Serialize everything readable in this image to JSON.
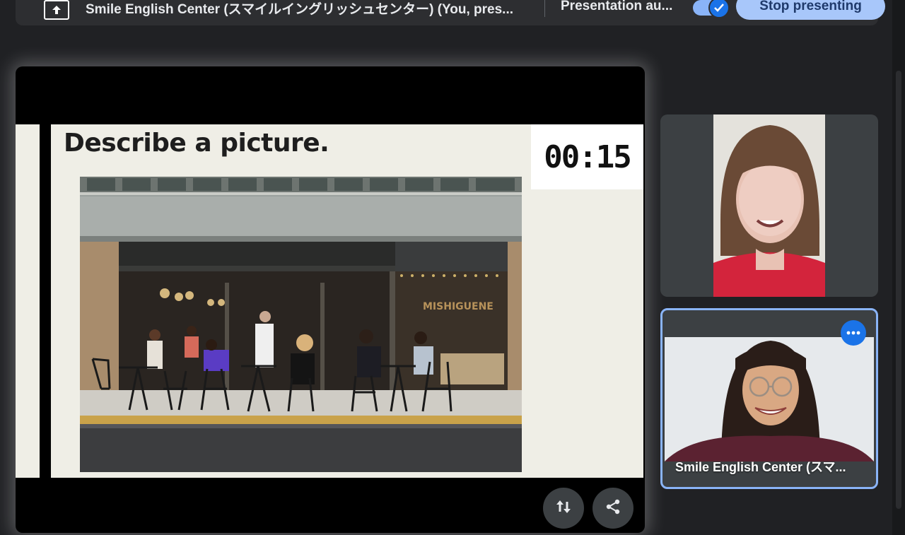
{
  "presenting_bar": {
    "title": "Smile English Center (スマイルイングリッシュセンター) (You, pres...",
    "autoplay_label": "Presentation au...",
    "autoplay_on": true,
    "stop_label": "Stop presenting",
    "icons": [
      "present-screen-icon",
      "check-icon"
    ]
  },
  "slide": {
    "heading": "Describe a picture.",
    "timer": "00:15",
    "photo_sign": "MISHIGUENE"
  },
  "controls": {
    "icons": [
      "swap-vertical-icon",
      "share-icon"
    ]
  },
  "participants": [
    {
      "name": "",
      "speaking": false
    },
    {
      "name": "Smile English Center (スマ...",
      "speaking": true,
      "more_icon": "more-horizontal-icon"
    }
  ],
  "colors": {
    "accent": "#1a73e8",
    "stop_button": "#a8c7fa",
    "background": "#202124"
  }
}
